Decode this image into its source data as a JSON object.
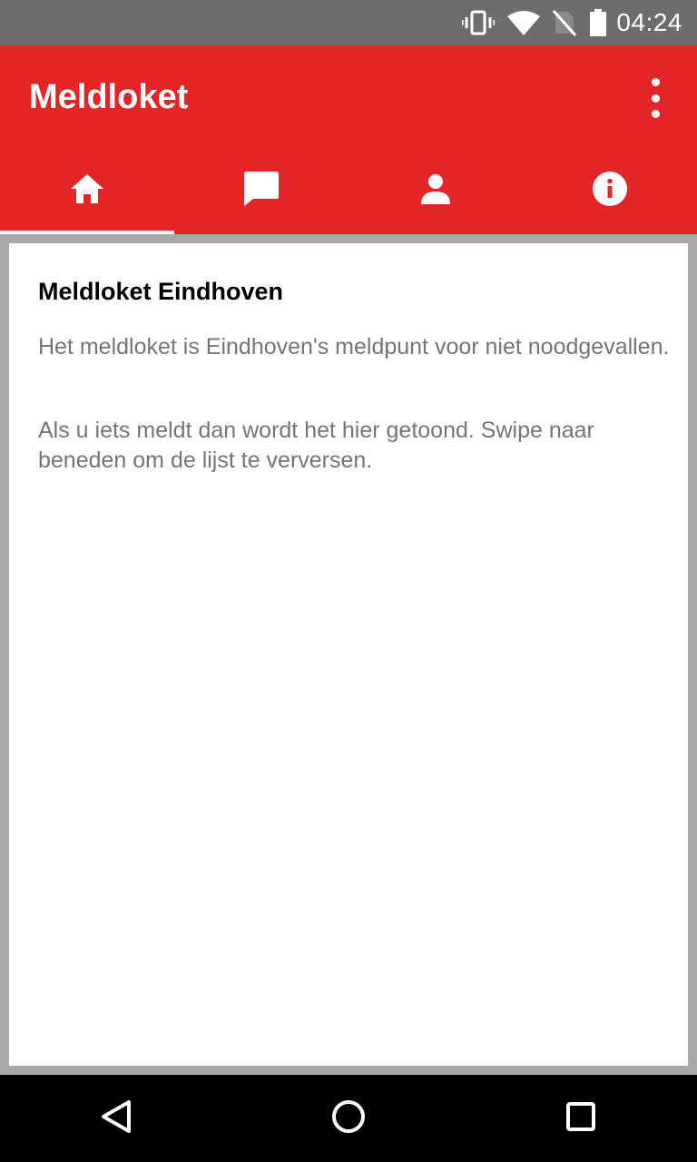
{
  "status_bar": {
    "time": "04:24",
    "icons": [
      "vibrate-icon",
      "wifi-icon",
      "no-sim-icon",
      "battery-icon"
    ]
  },
  "app_bar": {
    "title": "Meldloket",
    "menu_icon": "overflow-menu-icon",
    "background": "#e42528"
  },
  "tabs": [
    {
      "icon": "home-icon",
      "selected": true
    },
    {
      "icon": "chat-icon",
      "selected": false
    },
    {
      "icon": "person-icon",
      "selected": false
    },
    {
      "icon": "info-icon",
      "selected": false
    }
  ],
  "content": {
    "title": "Meldloket Eindhoven",
    "paragraph1": "Het meldloket is Eindhoven's meldpunt voor niet noodgevallen.",
    "paragraph2": "Als u iets meldt dan wordt het hier getoond. Swipe naar beneden om de lijst te verversen."
  },
  "nav_bar": {
    "buttons": [
      "back-icon",
      "home-circle-icon",
      "recents-icon"
    ]
  }
}
